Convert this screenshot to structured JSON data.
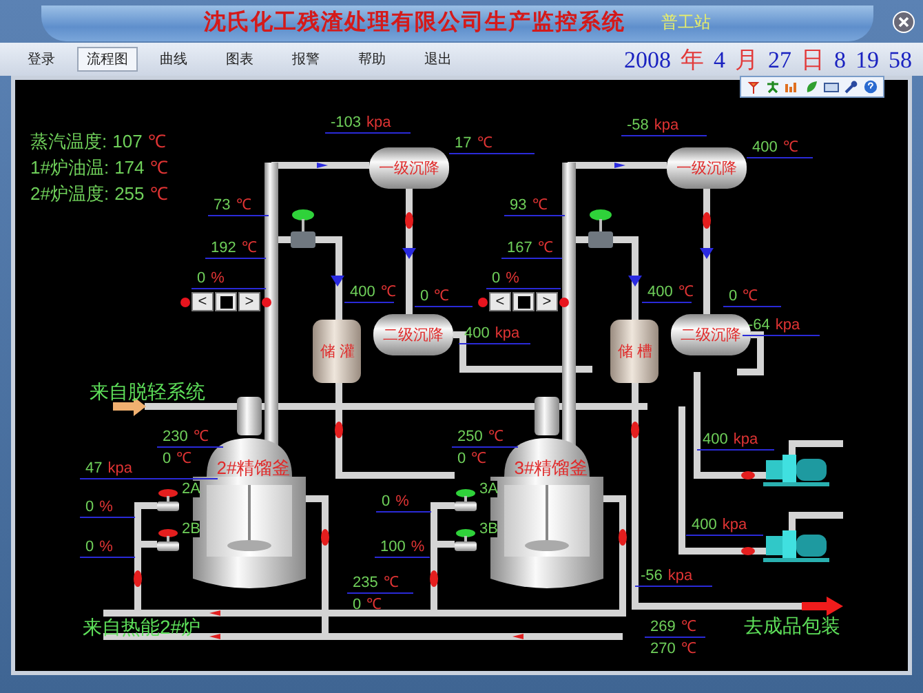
{
  "window": {
    "title": "沈氏化工残渣处理有限公司生产监控系统",
    "station": "普工站"
  },
  "menu": [
    {
      "label": "登录",
      "selected": false
    },
    {
      "label": "流程图",
      "selected": true
    },
    {
      "label": "曲线",
      "selected": false
    },
    {
      "label": "图表",
      "selected": false
    },
    {
      "label": "报警",
      "selected": false
    },
    {
      "label": "帮助",
      "selected": false
    },
    {
      "label": "退出",
      "selected": false
    }
  ],
  "datetime": [
    {
      "text": "2008",
      "kind": "number"
    },
    {
      "text": "年",
      "kind": "unit"
    },
    {
      "text": "4",
      "kind": "number"
    },
    {
      "text": "月",
      "kind": "unit"
    },
    {
      "text": "27",
      "kind": "number"
    },
    {
      "text": "日",
      "kind": "unit"
    },
    {
      "text": "8",
      "kind": "number"
    },
    {
      "text": "19",
      "kind": "number"
    },
    {
      "text": "58",
      "kind": "number"
    }
  ],
  "status_panel": [
    {
      "label": "蒸汽温度:",
      "value": "107",
      "unit": "℃"
    },
    {
      "label": "1#炉油温:",
      "value": "174",
      "unit": "℃"
    },
    {
      "label": "2#炉温度:",
      "value": "255",
      "unit": "℃"
    }
  ],
  "readings": [
    {
      "value": "-103",
      "unit": "kpa"
    },
    {
      "value": "17",
      "unit": "℃"
    },
    {
      "value": "73",
      "unit": "℃"
    },
    {
      "value": "192",
      "unit": "℃"
    },
    {
      "value": "0",
      "unit": "%"
    },
    {
      "value": "400",
      "unit": "℃"
    },
    {
      "value": "0",
      "unit": "℃"
    },
    {
      "value": "400",
      "unit": "kpa"
    },
    {
      "value": "-58",
      "unit": "kpa"
    },
    {
      "value": "400",
      "unit": "℃"
    },
    {
      "value": "93",
      "unit": "℃"
    },
    {
      "value": "167",
      "unit": "℃"
    },
    {
      "value": "0",
      "unit": "%"
    },
    {
      "value": "400",
      "unit": "℃"
    },
    {
      "value": "0",
      "unit": "℃"
    },
    {
      "value": "-64",
      "unit": "kpa"
    },
    {
      "value": "230",
      "unit": "℃"
    },
    {
      "value": "0",
      "unit": "℃"
    },
    {
      "value": "47",
      "unit": "kpa"
    },
    {
      "value": "0",
      "unit": "%"
    },
    {
      "value": "0",
      "unit": "%"
    },
    {
      "value": "235",
      "unit": "℃"
    },
    {
      "value": "0",
      "unit": "℃"
    },
    {
      "value": "250",
      "unit": "℃"
    },
    {
      "value": "0",
      "unit": "℃"
    },
    {
      "value": "0",
      "unit": "%"
    },
    {
      "value": "100",
      "unit": "%"
    },
    {
      "value": "400",
      "unit": "kpa"
    },
    {
      "value": "400",
      "unit": "kpa"
    },
    {
      "value": "-56",
      "unit": "kpa"
    },
    {
      "value": "269",
      "unit": "℃"
    },
    {
      "value": "270",
      "unit": "℃"
    }
  ],
  "units": [
    {
      "separator_1": "一级沉降",
      "separator_2": "二级沉降",
      "storage_tank": "储 灌",
      "control_valve": {
        "open": true
      },
      "controller": {
        "decrease": "<",
        "increase": ">"
      },
      "reactor": {
        "label": "2#精馏釜",
        "valves": [
          {
            "label": "2A",
            "open": false
          },
          {
            "label": "2B",
            "open": false
          }
        ]
      }
    },
    {
      "separator_1": "一级沉降",
      "separator_2": "二级沉降",
      "storage_tank": "储 槽",
      "control_valve": {
        "open": true
      },
      "controller": {
        "decrease": "<",
        "increase": ">"
      },
      "reactor": {
        "label": "3#精馏釜",
        "valves": [
          {
            "label": "3A",
            "open": true
          },
          {
            "label": "3B",
            "open": true
          }
        ]
      }
    }
  ],
  "flow_labels": [
    "来自脱轻系统",
    "来自热能2#炉",
    "去成品包装"
  ]
}
